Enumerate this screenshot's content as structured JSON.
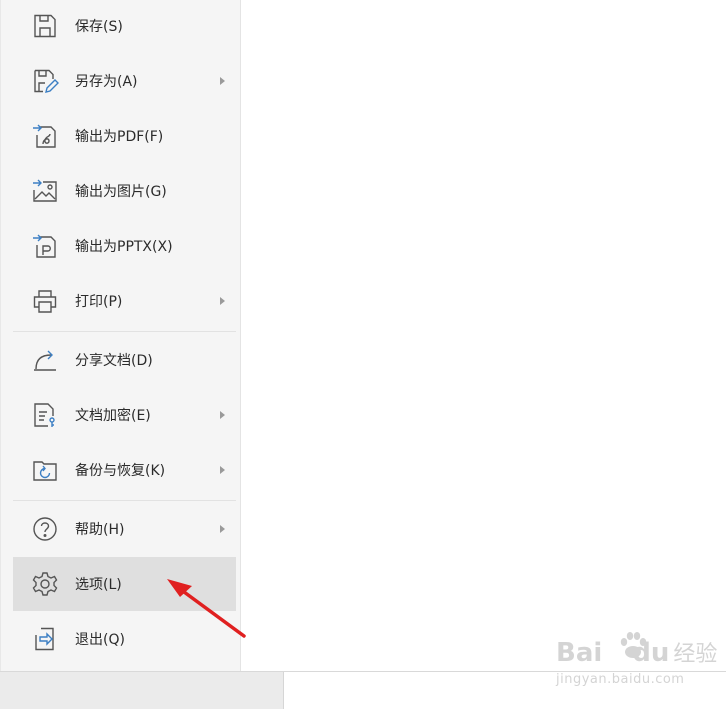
{
  "menu": {
    "items": [
      {
        "id": "save",
        "label": "保存(S)",
        "icon": "save-icon",
        "submenu": false
      },
      {
        "id": "save-as",
        "label": "另存为(A)",
        "icon": "save-as-icon",
        "submenu": true
      },
      {
        "id": "export-pdf",
        "label": "输出为PDF(F)",
        "icon": "export-pdf-icon",
        "submenu": false
      },
      {
        "id": "export-image",
        "label": "输出为图片(G)",
        "icon": "export-image-icon",
        "submenu": false
      },
      {
        "id": "export-pptx",
        "label": "输出为PPTX(X)",
        "icon": "export-pptx-icon",
        "submenu": false
      },
      {
        "id": "print",
        "label": "打印(P)",
        "icon": "printer-icon",
        "submenu": true
      },
      {
        "id": "share",
        "label": "分享文档(D)",
        "icon": "share-icon",
        "submenu": false
      },
      {
        "id": "encrypt",
        "label": "文档加密(E)",
        "icon": "document-lock-icon",
        "submenu": true
      },
      {
        "id": "backup",
        "label": "备份与恢复(K)",
        "icon": "backup-restore-icon",
        "submenu": true
      },
      {
        "id": "help",
        "label": "帮助(H)",
        "icon": "help-icon",
        "submenu": true
      },
      {
        "id": "options",
        "label": "选项(L)",
        "icon": "gear-icon",
        "submenu": false,
        "selected": true
      },
      {
        "id": "exit",
        "label": "退出(Q)",
        "icon": "exit-icon",
        "submenu": false
      }
    ]
  },
  "watermark": {
    "brand": "Bai",
    "brand2": "du",
    "brand3": "经验",
    "sub": "jingyan.baidu.com"
  },
  "colors": {
    "menu_bg": "#f5f5f5",
    "selected_bg": "#dfdfdf",
    "text": "#2b2b2b",
    "icon": "#555555",
    "annotation": "#e02020"
  }
}
